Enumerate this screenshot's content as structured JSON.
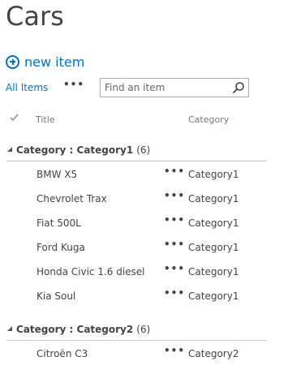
{
  "page": {
    "title": "Cars"
  },
  "toolbar": {
    "new_item_label": "new item",
    "view_label": "All Items",
    "view_menu": "•••",
    "search_placeholder": "Find an item"
  },
  "columns": {
    "title": "Title",
    "category": "Category"
  },
  "row_menu": "•••",
  "groups": [
    {
      "label": "Category : Category1",
      "count": "(6)",
      "rows": [
        {
          "title": "BMW X5",
          "category": "Category1"
        },
        {
          "title": "Chevrolet Trax",
          "category": "Category1"
        },
        {
          "title": "Fiat 500L",
          "category": "Category1"
        },
        {
          "title": "Ford Kuga",
          "category": "Category1"
        },
        {
          "title": "Honda Civic 1.6 diesel",
          "category": "Category1"
        },
        {
          "title": "Kia Soul",
          "category": "Category1"
        }
      ]
    },
    {
      "label": "Category : Category2",
      "count": "(6)",
      "rows": [
        {
          "title": "Citroën C3",
          "category": "Category2"
        }
      ]
    }
  ],
  "colors": {
    "accent": "#0072c6",
    "text": "#444444",
    "muted": "#777777",
    "divider": "#c6c6c6"
  },
  "icons": {
    "new_item": "plus-circle-icon",
    "search": "search-icon",
    "select_all": "check-icon",
    "group_toggle": "collapse-triangle-icon"
  }
}
